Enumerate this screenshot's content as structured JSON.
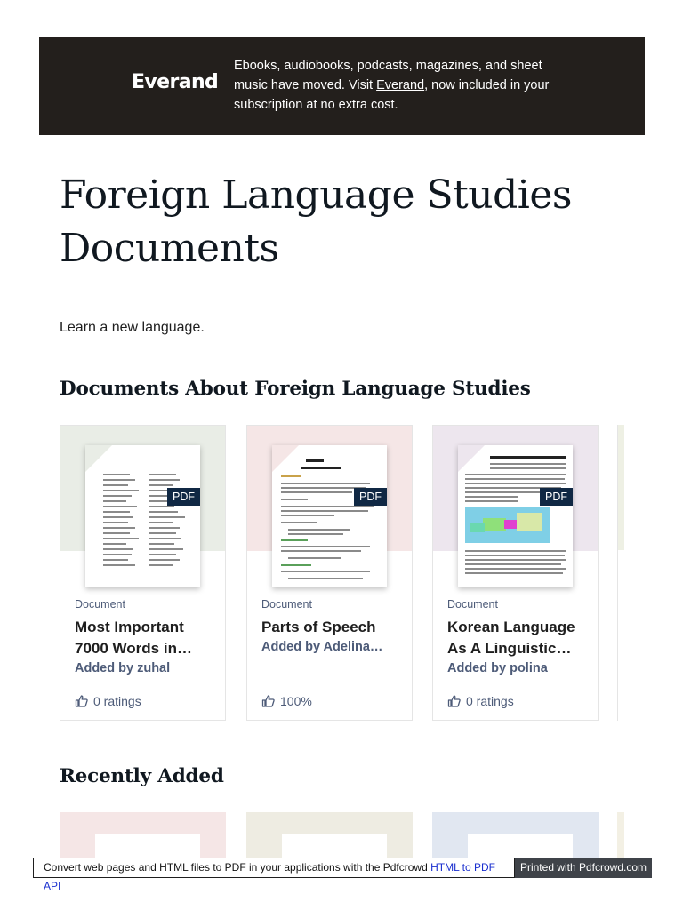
{
  "banner": {
    "logo": "Everand",
    "text_before": "Ebooks, audiobooks, podcasts, magazines, and sheet music have moved. Visit ",
    "link": "Everand",
    "text_after": ", now included in your subscription at no extra cost.",
    "background": "#231f1c"
  },
  "page": {
    "title": "Foreign Language Studies Documents",
    "subtitle": "Learn a new language."
  },
  "sections": {
    "documents_title": "Documents About Foreign Language Studies",
    "recent_title": "Recently Added"
  },
  "cards": [
    {
      "type": "Document",
      "title": "Most Important 7000 Words in…",
      "author": "Added by zuhal",
      "rating": "0 ratings",
      "badge": "PDF",
      "thumb_bg": "#e9ede6"
    },
    {
      "type": "Document",
      "title": "Parts of Speech",
      "author": "Added by Adelina…",
      "rating": "100%",
      "badge": "PDF",
      "thumb_bg": "#f5e6e6"
    },
    {
      "type": "Document",
      "title": "Korean Language As A Linguistic…",
      "author": "Added by polina",
      "rating": "0 ratings",
      "badge": "PDF",
      "thumb_bg": "#ede6ee"
    }
  ],
  "recent_thumbs": [
    "#f5e6e6",
    "#eeece2",
    "#e1e7f1"
  ],
  "footer": {
    "text": "Convert web pages and HTML files to PDF in your applications with the Pdfcrowd ",
    "link": "HTML to PDF API",
    "right": "Printed with Pdfcrowd.com"
  },
  "icons": {
    "rating": "thumbs-up-icon"
  }
}
